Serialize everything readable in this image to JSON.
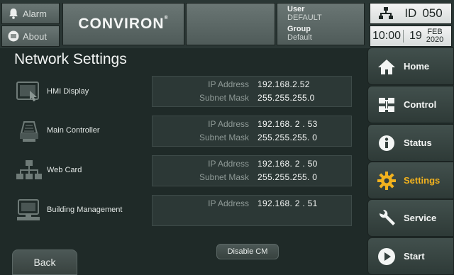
{
  "header": {
    "alarm_label": "Alarm",
    "about_label": "About",
    "logo_text": "CONVIRON",
    "logo_mark": "®",
    "user_key": "User",
    "user_value": "DEFAULT",
    "group_key": "Group",
    "group_value": "Default",
    "id_label": "ID",
    "id_value": "050",
    "time": "10:00",
    "day": "19",
    "month": "FEB",
    "year": "2020"
  },
  "page": {
    "title": "Network Settings",
    "back_label": "Back",
    "disable_label": "Disable CM"
  },
  "devices": [
    {
      "name": "HMI Display",
      "icon": "touchscreen-icon",
      "ip_label": "IP Address",
      "ip": "192.168.2.52",
      "mask_label": "Subnet Mask",
      "mask": "255.255.255.0"
    },
    {
      "name": "Main Controller",
      "icon": "controller-icon",
      "ip_label": "IP Address",
      "ip": "192.168.  2  .  53",
      "mask_label": "Subnet Mask",
      "mask": "255.255.255.  0"
    },
    {
      "name": "Web Card",
      "icon": "network-icon",
      "ip_label": "IP Address",
      "ip": "192.168.  2  .  50",
      "mask_label": "Subnet Mask",
      "mask": "255.255.255.  0"
    },
    {
      "name": "Building Management",
      "icon": "computer-icon",
      "ip_label": "IP Address",
      "ip": "192.168.  2  .  51"
    }
  ],
  "nav": [
    {
      "label": "Home",
      "icon": "home-icon"
    },
    {
      "label": "Control",
      "icon": "control-icon"
    },
    {
      "label": "Status",
      "icon": "info-icon"
    },
    {
      "label": "Settings",
      "icon": "gear-icon"
    },
    {
      "label": "Service",
      "icon": "wrench-icon"
    },
    {
      "label": "Start",
      "icon": "play-icon"
    }
  ],
  "colors": {
    "active": "#f2b21e",
    "background": "#1f2a28"
  }
}
